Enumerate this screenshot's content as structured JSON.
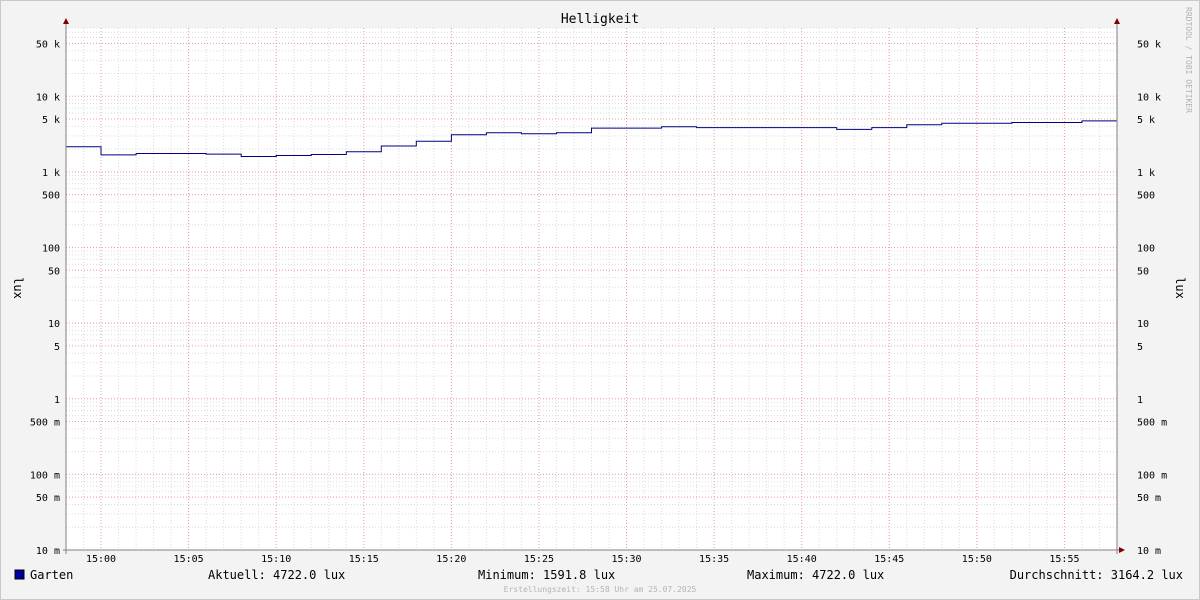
{
  "chart_data": {
    "type": "line",
    "title": "Helligkeit",
    "ylabel": "lux",
    "y_scale": "log",
    "ylim": [
      0.01,
      80000
    ],
    "y_ticks": [
      {
        "value": 0.01,
        "label": "10 m"
      },
      {
        "value": 0.05,
        "label": "50 m"
      },
      {
        "value": 0.1,
        "label": "100 m"
      },
      {
        "value": 0.5,
        "label": "500 m"
      },
      {
        "value": 1,
        "label": "1"
      },
      {
        "value": 5,
        "label": "5"
      },
      {
        "value": 10,
        "label": "10"
      },
      {
        "value": 50,
        "label": "50"
      },
      {
        "value": 100,
        "label": "100"
      },
      {
        "value": 500,
        "label": "500"
      },
      {
        "value": 1000,
        "label": "1 k"
      },
      {
        "value": 5000,
        "label": "5 k"
      },
      {
        "value": 10000,
        "label": "10 k"
      },
      {
        "value": 50000,
        "label": "50 k"
      }
    ],
    "x_ticks": [
      "15:00",
      "15:05",
      "15:10",
      "15:15",
      "15:20",
      "15:25",
      "15:30",
      "15:35",
      "15:40",
      "15:45",
      "15:50",
      "15:55"
    ],
    "xlim": [
      "14:58",
      "15:58"
    ],
    "grid": true,
    "series": [
      {
        "name": "Garten",
        "color": "#000080",
        "x": [
          "14:58",
          "15:00",
          "15:02",
          "15:04",
          "15:06",
          "15:08",
          "15:10",
          "15:12",
          "15:14",
          "15:16",
          "15:18",
          "15:20",
          "15:22",
          "15:24",
          "15:26",
          "15:28",
          "15:30",
          "15:32",
          "15:34",
          "15:36",
          "15:38",
          "15:40",
          "15:42",
          "15:44",
          "15:46",
          "15:48",
          "15:50",
          "15:52",
          "15:54",
          "15:56"
        ],
        "values": [
          2150,
          1680,
          1750,
          1750,
          1720,
          1600,
          1650,
          1700,
          1850,
          2200,
          2550,
          3100,
          3300,
          3200,
          3300,
          3800,
          3800,
          3950,
          3850,
          3850,
          3850,
          3850,
          3650,
          3850,
          4200,
          4400,
          4400,
          4500,
          4500,
          4722
        ]
      }
    ]
  },
  "legend": {
    "swatch_color": "#0000a0",
    "series_name": "Garten",
    "current": "Aktuell: 4722.0 lux",
    "minimum": "Minimum: 1591.8 lux",
    "maximum": "Maximum: 4722.0 lux",
    "average": "Durchschnitt: 3164.2 lux"
  },
  "footer": "Erstellungszeit: 15:58 Uhr am 25.07.2025",
  "watermark": "RRDTOOL / TOBI OETIKER"
}
